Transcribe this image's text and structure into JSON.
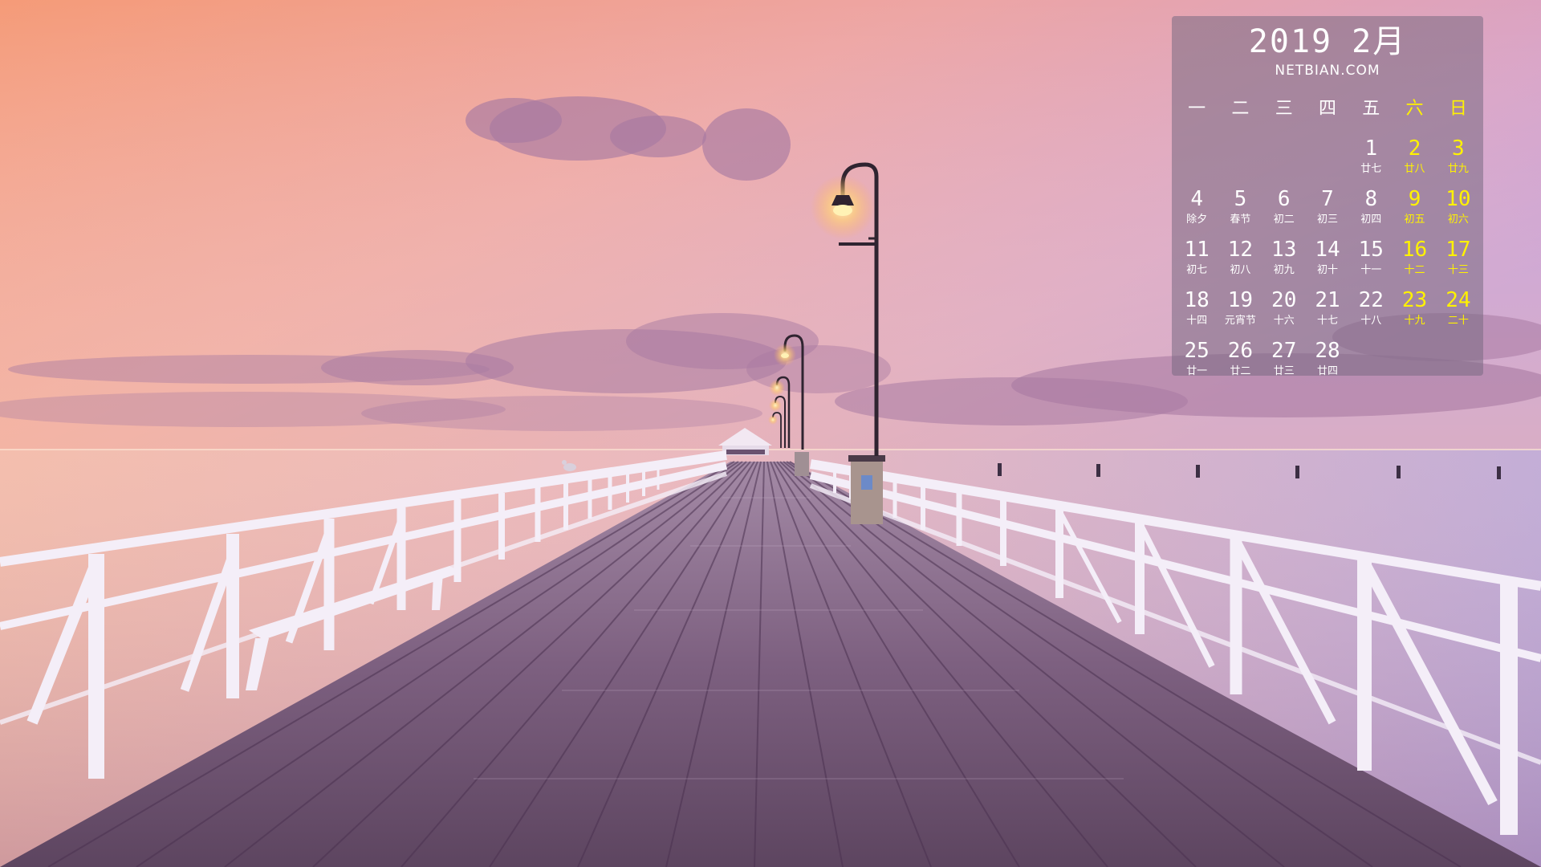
{
  "calendar": {
    "year": "2019",
    "month": "2月",
    "site": "NETBIAN.COM",
    "weekdays": [
      {
        "label": "一",
        "weekend": false
      },
      {
        "label": "二",
        "weekend": false
      },
      {
        "label": "三",
        "weekend": false
      },
      {
        "label": "四",
        "weekend": false
      },
      {
        "label": "五",
        "weekend": false
      },
      {
        "label": "六",
        "weekend": true
      },
      {
        "label": "日",
        "weekend": true
      }
    ],
    "leading_blank_days": 4,
    "days": [
      {
        "num": "1",
        "lunar": "廿七"
      },
      {
        "num": "2",
        "lunar": "廿八"
      },
      {
        "num": "3",
        "lunar": "廿九"
      },
      {
        "num": "4",
        "lunar": "除夕"
      },
      {
        "num": "5",
        "lunar": "春节"
      },
      {
        "num": "6",
        "lunar": "初二"
      },
      {
        "num": "7",
        "lunar": "初三"
      },
      {
        "num": "8",
        "lunar": "初四"
      },
      {
        "num": "9",
        "lunar": "初五"
      },
      {
        "num": "10",
        "lunar": "初六"
      },
      {
        "num": "11",
        "lunar": "初七"
      },
      {
        "num": "12",
        "lunar": "初八"
      },
      {
        "num": "13",
        "lunar": "初九"
      },
      {
        "num": "14",
        "lunar": "初十"
      },
      {
        "num": "15",
        "lunar": "十一"
      },
      {
        "num": "16",
        "lunar": "十二"
      },
      {
        "num": "17",
        "lunar": "十三"
      },
      {
        "num": "18",
        "lunar": "十四"
      },
      {
        "num": "19",
        "lunar": "元宵节"
      },
      {
        "num": "20",
        "lunar": "十六"
      },
      {
        "num": "21",
        "lunar": "十七"
      },
      {
        "num": "22",
        "lunar": "十八"
      },
      {
        "num": "23",
        "lunar": "十九"
      },
      {
        "num": "24",
        "lunar": "二十"
      },
      {
        "num": "25",
        "lunar": "廿一"
      },
      {
        "num": "26",
        "lunar": "廿二"
      },
      {
        "num": "27",
        "lunar": "廿三"
      },
      {
        "num": "28",
        "lunar": "廿四"
      }
    ]
  },
  "colors": {
    "sky_top": "#f2a07e",
    "sky_mid": "#e8a9b6",
    "sky_right": "#c79bd0",
    "sea": "#c9a2c4",
    "deck": "#7a5a78",
    "railing": "#f4eef8",
    "weekend_text": "#fff200",
    "panel": "rgba(120,105,130,0.55)"
  }
}
